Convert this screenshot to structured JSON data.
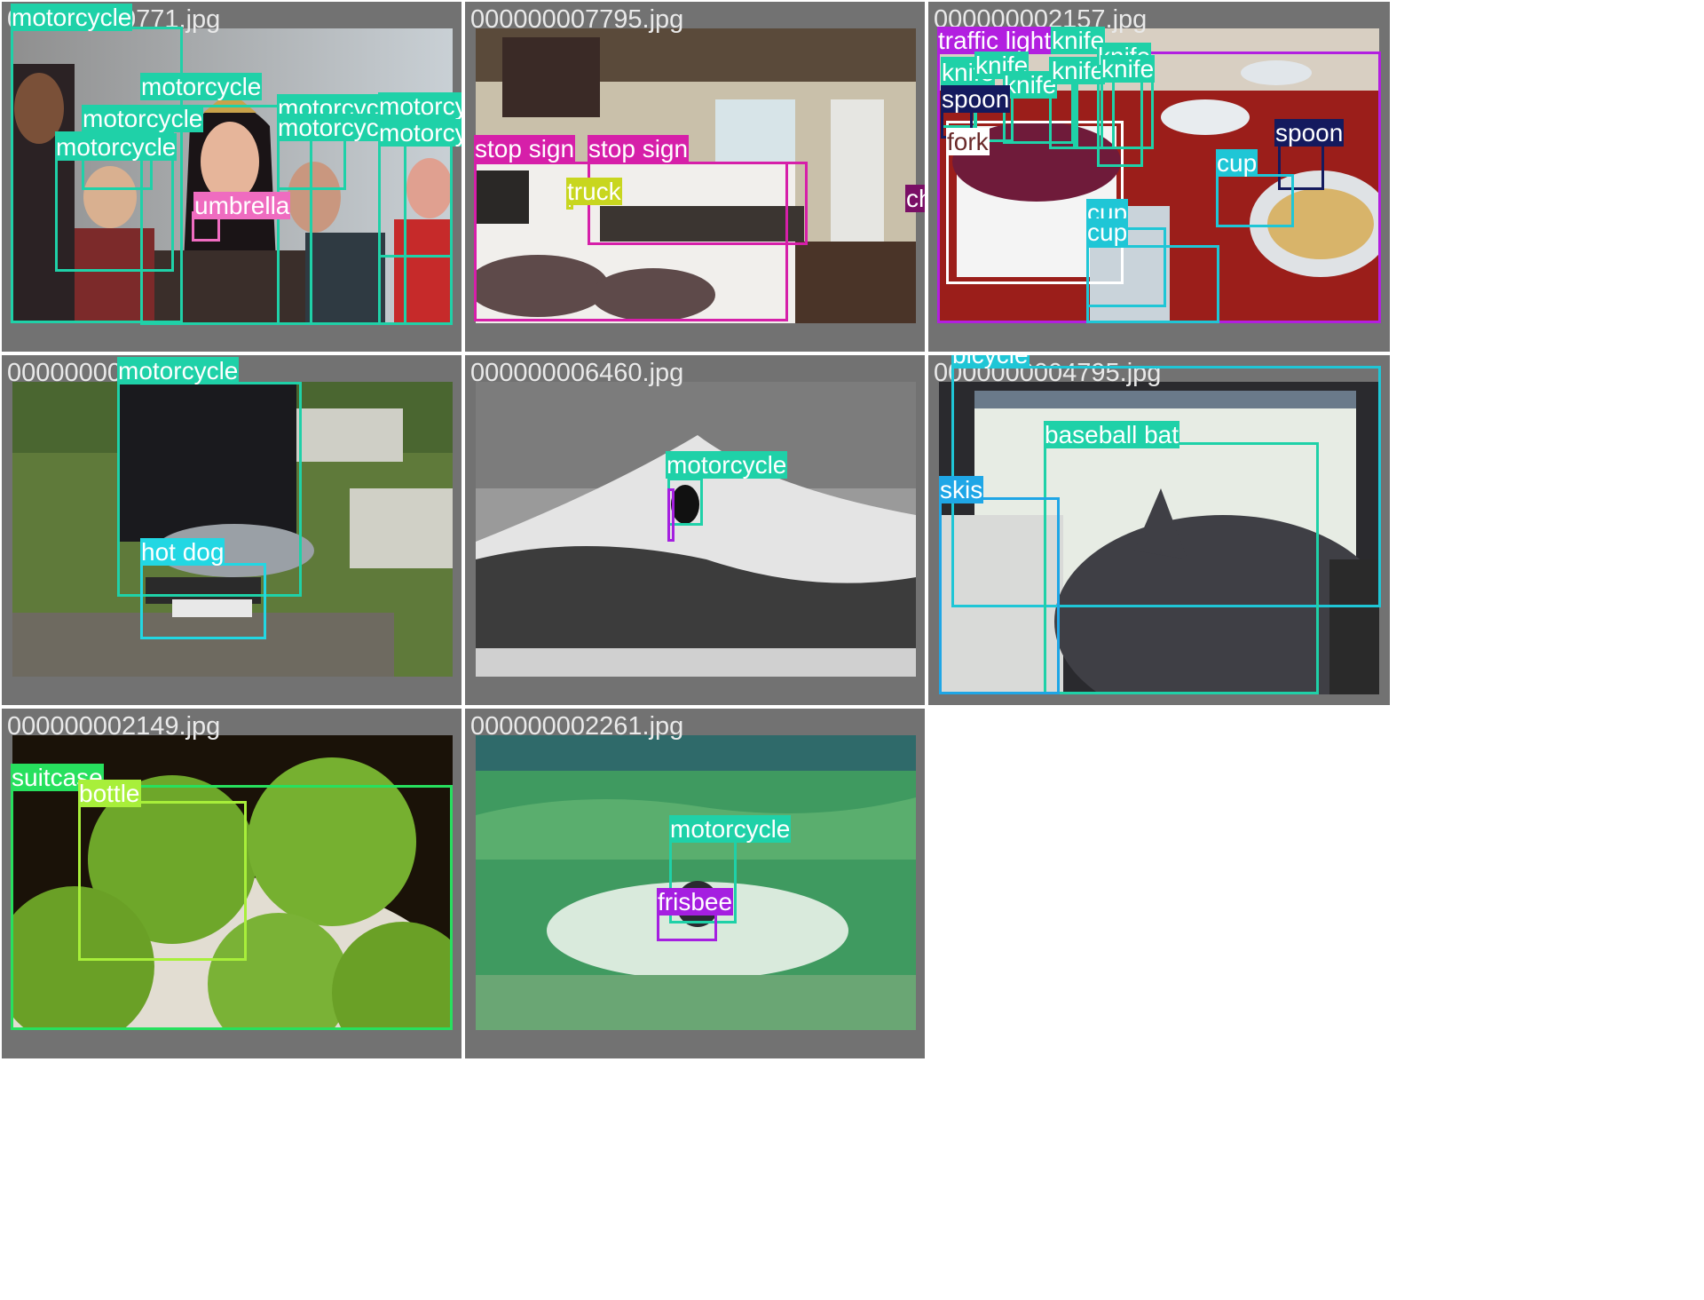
{
  "mosaic": {
    "cells": [
      {
        "filename": "000000000771.jpg",
        "scene": "crowd",
        "detections": [
          {
            "label": "motorcycle",
            "color": "#1fd1a8"
          },
          {
            "label": "motorcycle",
            "color": "#1fd1a8"
          },
          {
            "label": "motorcycle",
            "color": "#1fd1a8"
          },
          {
            "label": "motorcycle",
            "color": "#1fd1a8"
          },
          {
            "label": "motorcycle",
            "color": "#1fd1a8"
          },
          {
            "label": "motorcycle",
            "color": "#1fd1a8"
          },
          {
            "label": "motorcycle",
            "color": "#1fd1a8"
          },
          {
            "label": "motorcycle",
            "color": "#1fd1a8"
          },
          {
            "label": "umbrella",
            "color": "#ef6cc0"
          }
        ]
      },
      {
        "filename": "000000007795.jpg",
        "scene": "bedroom",
        "detections": [
          {
            "label": "stop sign",
            "color": "#d61fa9"
          },
          {
            "label": "stop sign",
            "color": "#d61fa9"
          },
          {
            "label": "truck",
            "color": "#c8d61f"
          },
          {
            "label": "chair",
            "color": "#7a0f66"
          }
        ]
      },
      {
        "filename": "000000002157.jpg",
        "scene": "table",
        "detections": [
          {
            "label": "traffic light",
            "color": "#b21fe0"
          },
          {
            "label": "knife",
            "color": "#1fd1a8"
          },
          {
            "label": "knife",
            "color": "#1fd1a8"
          },
          {
            "label": "knife",
            "color": "#1fd1a8"
          },
          {
            "label": "knife",
            "color": "#1fd1a8"
          },
          {
            "label": "knife",
            "color": "#1fd1a8"
          },
          {
            "label": "knife",
            "color": "#1fd1a8"
          },
          {
            "label": "knife",
            "color": "#1fd1a8"
          },
          {
            "label": "spoon",
            "color": "#141a5e"
          },
          {
            "label": "spoon",
            "color": "#141a5e"
          },
          {
            "label": "fork",
            "color": "#ffffff"
          },
          {
            "label": "cup",
            "color": "#1fc6d6"
          },
          {
            "label": "cup",
            "color": "#1fc6d6"
          },
          {
            "label": "cup",
            "color": "#1fc6d6"
          }
        ]
      },
      {
        "filename": "000000003xxx.jpg",
        "filename_visible": "00000000003",
        "scene": "skate",
        "detections": [
          {
            "label": "motorcycle",
            "color": "#1fd1a8"
          },
          {
            "label": "hot dog",
            "color": "#22d7e3"
          }
        ]
      },
      {
        "filename": "000000006460.jpg",
        "scene": "wave",
        "detections": [
          {
            "label": "motorcycle",
            "color": "#1fd1a8"
          }
        ]
      },
      {
        "filename_visible": "0000000004795.jpg",
        "scene": "cat",
        "detections": [
          {
            "label": "bicycle",
            "color": "#1fc6d6"
          },
          {
            "label": "baseball bat",
            "color": "#1fd1a8"
          },
          {
            "label": "skis",
            "color": "#1fa6e6"
          }
        ]
      },
      {
        "filename": "000000002149.jpg",
        "scene": "apples",
        "detections": [
          {
            "label": "suitcase",
            "color": "#27e05e"
          },
          {
            "label": "bottle",
            "color": "#a8ef3a"
          }
        ]
      },
      {
        "filename": "000000002261.jpg",
        "scene": "surf",
        "detections": [
          {
            "label": "motorcycle",
            "color": "#1fd1a8"
          },
          {
            "label": "frisbee",
            "color": "#a51fe0"
          }
        ]
      }
    ]
  }
}
